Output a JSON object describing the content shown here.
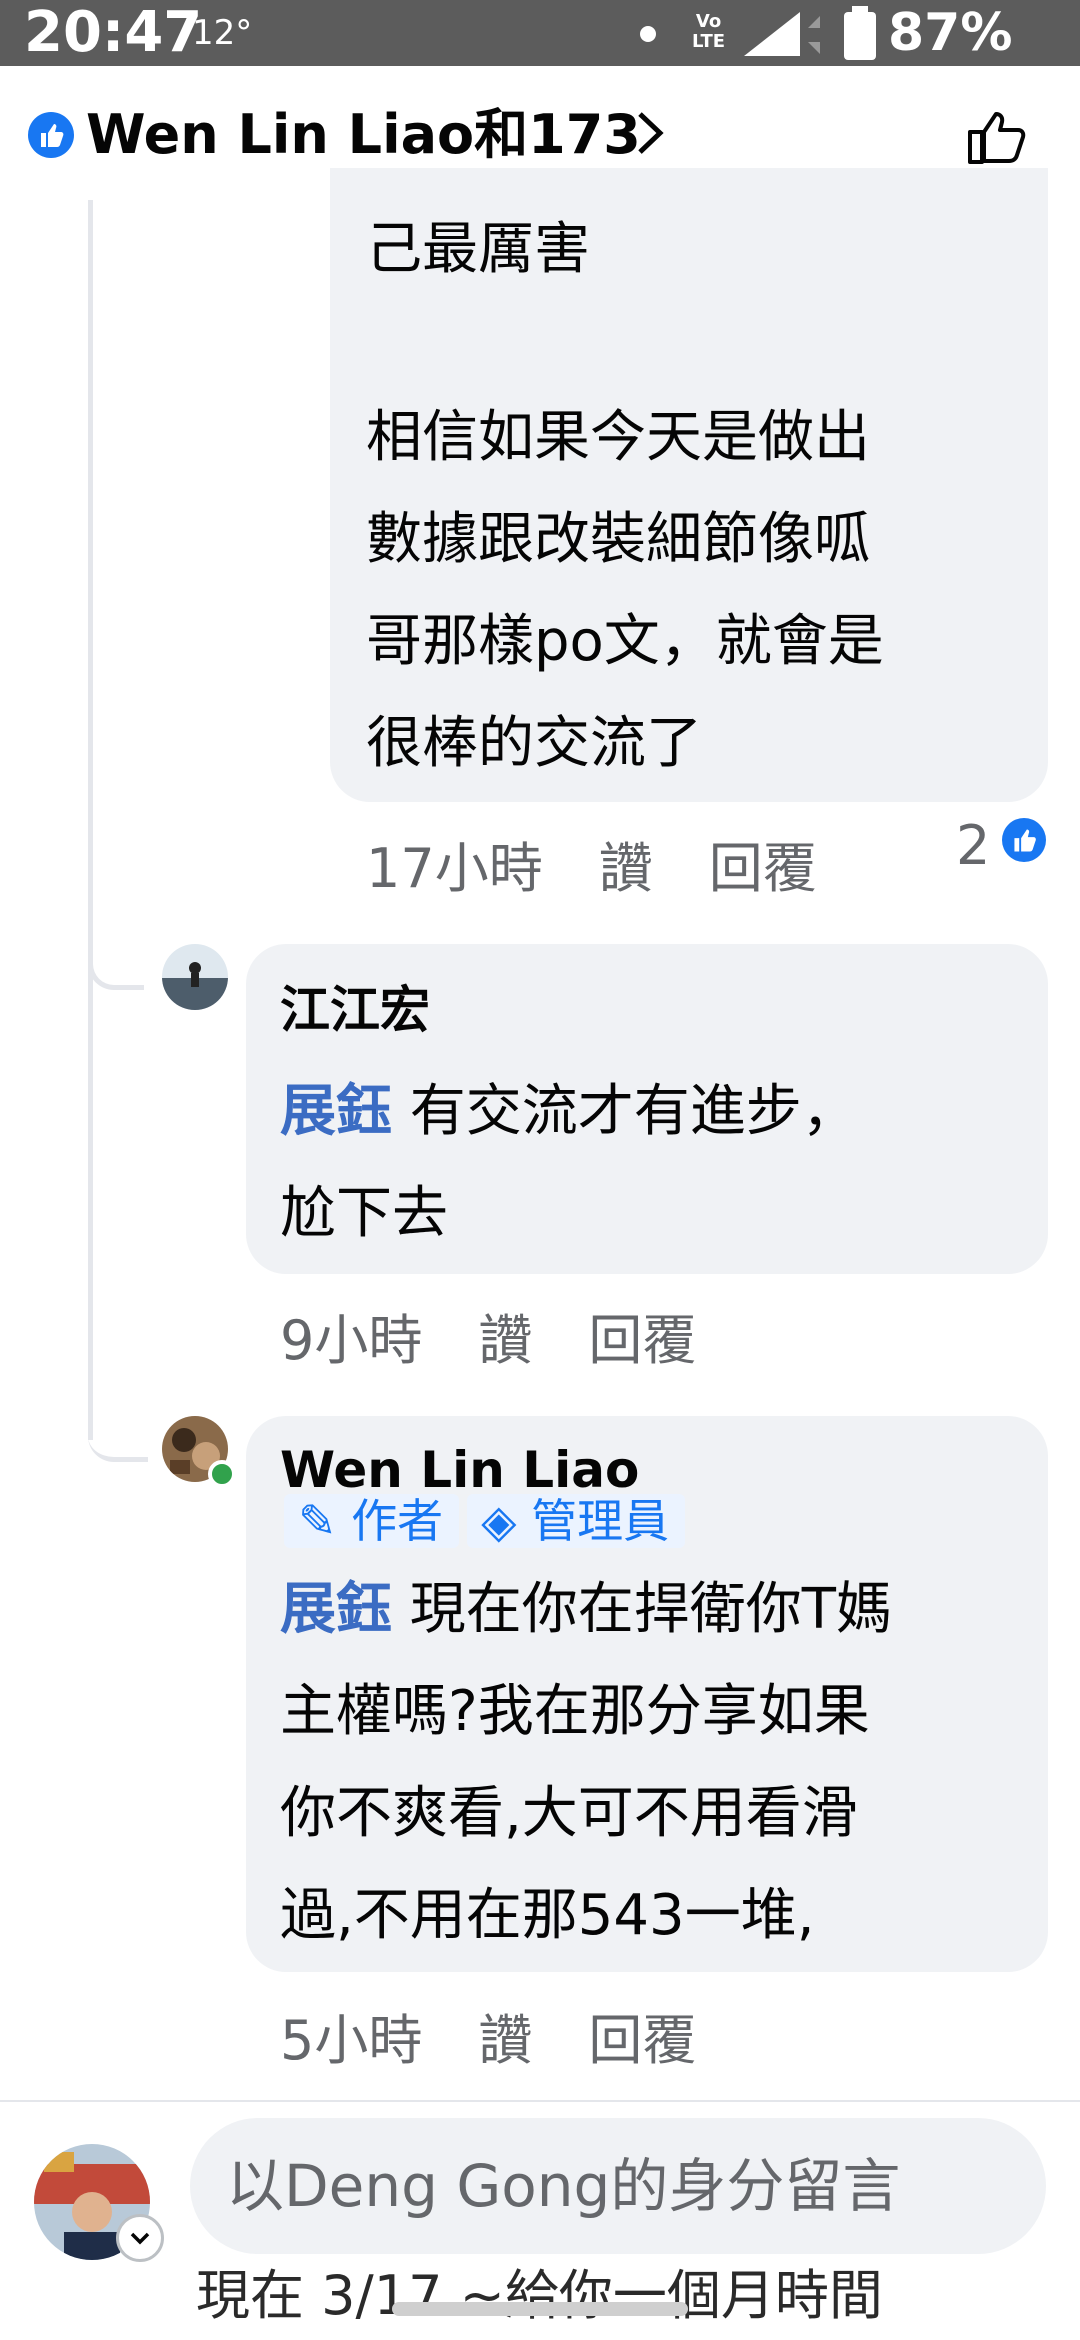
{
  "status_bar": {
    "time": "20:47",
    "temperature": "12°",
    "network": "LTE",
    "battery": "87%"
  },
  "header": {
    "title": "Wen Lin Liao和173"
  },
  "comments": [
    {
      "id": "c1",
      "text_lines": [
        "己最厲害",
        "",
        "相信如果今天是做出",
        "數據跟改裝細節像呱",
        "哥那樣po文，就會是",
        "很棒的交流了"
      ],
      "time": "17小時",
      "like_label": "讚",
      "reply_label": "回覆",
      "reaction_count": "2"
    },
    {
      "id": "c2",
      "author": "江江宏",
      "mention": "展鈺",
      "text_first": " 有交流才有進步，",
      "text_second": "尬下去",
      "time": "9小時",
      "like_label": "讚",
      "reply_label": "回覆"
    },
    {
      "id": "c3",
      "author": "Wen Lin Liao",
      "badges": [
        "作者",
        "管理員"
      ],
      "mention": "展鈺",
      "text_first": " 現在你在捍衛你T媽",
      "text_lines": [
        "主權嗎?我在那分享如果",
        "你不爽看,大可不用看滑",
        "過,不用在那543一堆,"
      ],
      "time": "5小時",
      "like_label": "讚",
      "reply_label": "回覆"
    }
  ],
  "composer": {
    "placeholder": "以Deng Gong的身分留言",
    "underlying_text": "現在 3/17 ~給你一個月時間"
  },
  "colors": {
    "accent": "#1877f2",
    "mention": "#3b6cc3",
    "bubble": "#f0f2f5",
    "meta": "#65676b"
  }
}
